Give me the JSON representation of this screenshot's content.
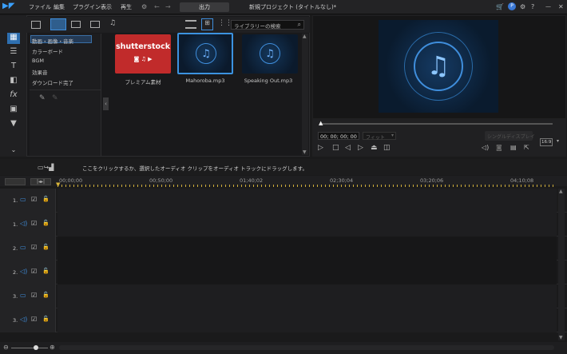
{
  "menu": {
    "app_icon": "powerdirector-logo-icon",
    "items": [
      "ファイル",
      "編集",
      "プラグイン",
      "表示",
      "再生"
    ],
    "output_label": "出力",
    "project_title": "新規プロジェクト (タイトルなし)*"
  },
  "library": {
    "search_placeholder": "ライブラリーの検索",
    "tree": [
      "動画・画像・音楽",
      "カラーボード",
      "BGM",
      "効果音",
      "ダウンロード完了"
    ],
    "items": [
      {
        "caption": "プレミアム素材",
        "logo_text": "shutterstock"
      },
      {
        "caption": "Mahoroba.mp3"
      },
      {
        "caption": "Speaking Out.mp3"
      }
    ]
  },
  "preview": {
    "timecode": "00; 00; 00; 00",
    "fit_label": "フィット",
    "aspect_label": "16:9",
    "snapshot_label": "シングルディスプレイ"
  },
  "hint": {
    "text": "ここをクリックするか、選択したオーディオ クリップをオーディオ トラックにドラッグします。"
  },
  "timeline": {
    "ruler": [
      "00;00;00",
      "00;50;00",
      "01;40;02",
      "02;30;04",
      "03;20;06",
      "04;10;08"
    ],
    "tracks": [
      {
        "label": "1.",
        "kind": "video"
      },
      {
        "label": "1.",
        "kind": "audio"
      },
      {
        "label": "2.",
        "kind": "video"
      },
      {
        "label": "2.",
        "kind": "audio"
      },
      {
        "label": "3.",
        "kind": "video"
      },
      {
        "label": "3.",
        "kind": "audio"
      }
    ]
  },
  "colors": {
    "accent": "#2e8fd8",
    "thumb_red": "#c12b2b",
    "playhead": "#d8b53a"
  }
}
